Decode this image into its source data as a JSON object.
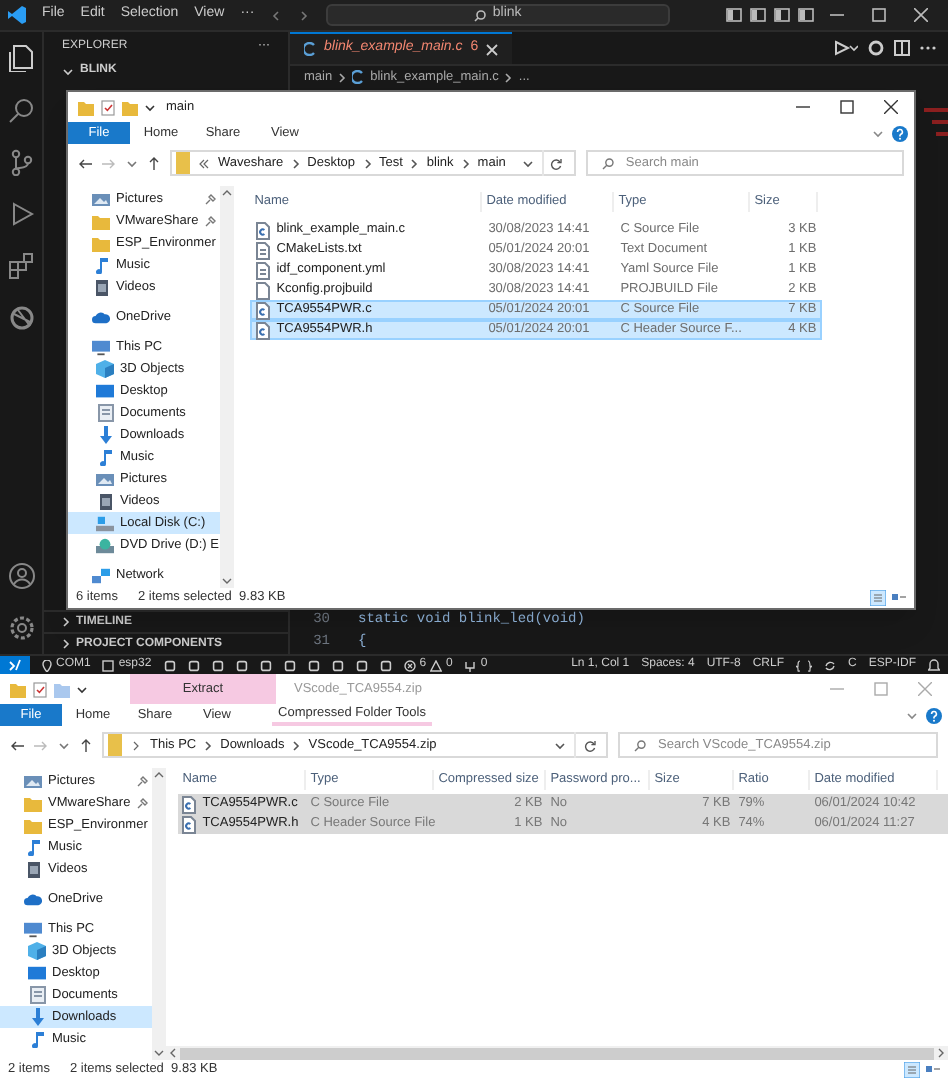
{
  "vscode": {
    "menu": [
      "File",
      "Edit",
      "Selection",
      "View",
      "···"
    ],
    "search": "blink",
    "sidebar": {
      "title": "EXPLORER",
      "more": "···",
      "folder": "BLINK",
      "sections": [
        "TIMELINE",
        "PROJECT COMPONENTS"
      ]
    },
    "tab": {
      "label": "blink_example_main.c",
      "badge": "6",
      "selected": true
    },
    "breadcrumbs": [
      "main",
      "blink_example_main.c",
      "..."
    ],
    "code_lines": [
      {
        "number": "30",
        "text": "static void blink_led(void)"
      },
      {
        "number": "31",
        "text": "{"
      }
    ],
    "status_bar": {
      "left": [
        "COM1",
        "esp32"
      ],
      "errors": "6",
      "warnings": "0",
      "ports": "0",
      "right": [
        "Ln 1, Col 1",
        "Spaces: 4",
        "UTF-8",
        "CRLF",
        "C",
        "ESP-IDF"
      ]
    }
  },
  "explorer_top": {
    "title": "main",
    "ribbon_tabs": [
      {
        "label": "File",
        "selected": true
      },
      {
        "label": "Home",
        "selected": false
      },
      {
        "label": "Share",
        "selected": false
      },
      {
        "label": "View",
        "selected": false
      }
    ],
    "path": [
      "Waveshare",
      "Desktop",
      "Test",
      "blink",
      "main"
    ],
    "search_placeholder": "Search main",
    "nav": [
      {
        "label": "Pictures",
        "kind": "pictures",
        "pinned": true,
        "selected": false
      },
      {
        "label": "VMwareShare",
        "kind": "folder",
        "pinned": true,
        "selected": false
      },
      {
        "label": "ESP_Environmer",
        "kind": "folder",
        "pinned": false,
        "selected": false
      },
      {
        "label": "Music",
        "kind": "music",
        "pinned": false,
        "selected": false
      },
      {
        "label": "Videos",
        "kind": "videos",
        "pinned": false,
        "selected": false
      },
      {
        "label": "OneDrive",
        "kind": "onedrive",
        "pinned": false,
        "selected": false
      },
      {
        "label": "This PC",
        "kind": "pc",
        "pinned": false,
        "selected": false,
        "children": [
          {
            "label": "3D Objects",
            "kind": "objects",
            "pinned": false,
            "selected": false
          },
          {
            "label": "Desktop",
            "kind": "desktop",
            "pinned": false,
            "selected": false
          },
          {
            "label": "Documents",
            "kind": "documents",
            "pinned": false,
            "selected": false
          },
          {
            "label": "Downloads",
            "kind": "downloads",
            "pinned": false,
            "selected": false
          },
          {
            "label": "Music",
            "kind": "music",
            "pinned": false,
            "selected": false
          },
          {
            "label": "Pictures",
            "kind": "pictures",
            "pinned": false,
            "selected": false
          },
          {
            "label": "Videos",
            "kind": "videos",
            "pinned": false,
            "selected": false
          },
          {
            "label": "Local Disk (C:)",
            "kind": "disk",
            "pinned": false,
            "selected": true
          },
          {
            "label": "DVD Drive (D:) E",
            "kind": "dvd",
            "pinned": false,
            "selected": false
          }
        ]
      },
      {
        "label": "Network",
        "kind": "network",
        "pinned": false,
        "selected": false
      }
    ],
    "columns": [
      "Name",
      "Date modified",
      "Type",
      "Size"
    ],
    "files": [
      {
        "name": "blink_example_main.c",
        "date": "30/08/2023 14:41",
        "type": "C Source File",
        "size": "3 KB",
        "kind": "c",
        "selected": false
      },
      {
        "name": "CMakeLists.txt",
        "date": "05/01/2024 20:01",
        "type": "Text Document",
        "size": "1 KB",
        "kind": "text",
        "selected": false
      },
      {
        "name": "idf_component.yml",
        "date": "30/08/2023 14:41",
        "type": "Yaml Source File",
        "size": "1 KB",
        "kind": "text",
        "selected": false
      },
      {
        "name": "Kconfig.projbuild",
        "date": "30/08/2023 14:41",
        "type": "PROJBUILD File",
        "size": "2 KB",
        "kind": "file",
        "selected": false
      },
      {
        "name": "TCA9554PWR.c",
        "date": "05/01/2024 20:01",
        "type": "C Source File",
        "size": "7 KB",
        "kind": "c",
        "selected": true
      },
      {
        "name": "TCA9554PWR.h",
        "date": "05/01/2024 20:01",
        "type": "C Header Source F...",
        "size": "4 KB",
        "kind": "c",
        "selected": true
      }
    ],
    "status": [
      "6 items",
      "2 items selected  9.83 KB"
    ]
  },
  "explorer_bottom": {
    "title": "VScode_TCA9554.zip",
    "context_tab": "Extract",
    "context_group": "Compressed Folder Tools",
    "ribbon_tabs": [
      {
        "label": "File",
        "selected": true
      },
      {
        "label": "Home",
        "selected": false
      },
      {
        "label": "Share",
        "selected": false
      },
      {
        "label": "View",
        "selected": false
      }
    ],
    "path": [
      "This PC",
      "Downloads",
      "VScode_TCA9554.zip"
    ],
    "search_placeholder": "Search VScode_TCA9554.zip",
    "nav": [
      {
        "label": "Pictures",
        "kind": "pictures",
        "pinned": true,
        "selected": false
      },
      {
        "label": "VMwareShare",
        "kind": "folder",
        "pinned": true,
        "selected": false
      },
      {
        "label": "ESP_Environmer",
        "kind": "folder",
        "pinned": false,
        "selected": false
      },
      {
        "label": "Music",
        "kind": "music",
        "pinned": false,
        "selected": false
      },
      {
        "label": "Videos",
        "kind": "videos",
        "pinned": false,
        "selected": false
      },
      {
        "label": "OneDrive",
        "kind": "onedrive",
        "pinned": false,
        "selected": false
      },
      {
        "label": "This PC",
        "kind": "pc",
        "pinned": false,
        "selected": false,
        "children": [
          {
            "label": "3D Objects",
            "kind": "objects",
            "pinned": false,
            "selected": false
          },
          {
            "label": "Desktop",
            "kind": "desktop",
            "pinned": false,
            "selected": false
          },
          {
            "label": "Documents",
            "kind": "documents",
            "pinned": false,
            "selected": false
          },
          {
            "label": "Downloads",
            "kind": "downloads",
            "pinned": false,
            "selected": true
          },
          {
            "label": "Music",
            "kind": "music",
            "pinned": false,
            "selected": false
          }
        ]
      }
    ],
    "columns": [
      "Name",
      "Type",
      "Compressed size",
      "Password pro...",
      "Size",
      "Ratio",
      "Date modified"
    ],
    "files": [
      {
        "name": "TCA9554PWR.c",
        "type": "C Source File",
        "compressed": "2 KB",
        "password": "No",
        "size": "7 KB",
        "ratio": "79%",
        "date": "06/01/2024 10:42",
        "kind": "c",
        "selected": true
      },
      {
        "name": "TCA9554PWR.h",
        "type": "C Header Source File",
        "compressed": "1 KB",
        "password": "No",
        "size": "4 KB",
        "ratio": "74%",
        "date": "06/01/2024 11:27",
        "kind": "c",
        "selected": true
      }
    ],
    "status": [
      "2 items",
      "2 items selected  9.83 KB"
    ]
  }
}
